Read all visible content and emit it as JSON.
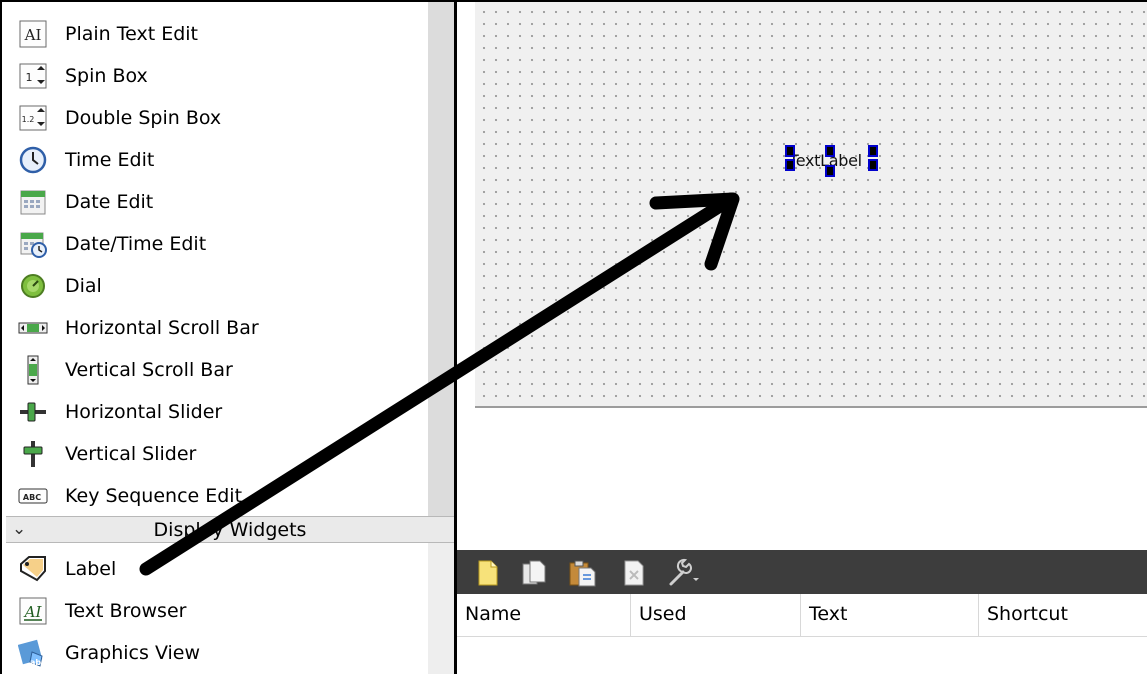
{
  "widget_box": {
    "items": [
      {
        "label": "Plain Text Edit",
        "icon": "plain-text-edit-icon"
      },
      {
        "label": "Spin Box",
        "icon": "spin-box-icon"
      },
      {
        "label": "Double Spin Box",
        "icon": "double-spin-box-icon"
      },
      {
        "label": "Time Edit",
        "icon": "time-edit-icon"
      },
      {
        "label": "Date Edit",
        "icon": "date-edit-icon"
      },
      {
        "label": "Date/Time Edit",
        "icon": "date-time-edit-icon"
      },
      {
        "label": "Dial",
        "icon": "dial-icon"
      },
      {
        "label": "Horizontal Scroll Bar",
        "icon": "horizontal-scroll-bar-icon"
      },
      {
        "label": "Vertical Scroll Bar",
        "icon": "vertical-scroll-bar-icon"
      },
      {
        "label": "Horizontal Slider",
        "icon": "horizontal-slider-icon"
      },
      {
        "label": "Vertical Slider",
        "icon": "vertical-slider-icon"
      },
      {
        "label": "Key Sequence Edit",
        "icon": "key-sequence-edit-icon"
      }
    ],
    "category": {
      "label": "Display Widgets",
      "chevron": "chevron-down-icon"
    },
    "display_items": [
      {
        "label": "Label",
        "icon": "label-icon"
      },
      {
        "label": "Text Browser",
        "icon": "text-browser-icon"
      },
      {
        "label": "Graphics View",
        "icon": "graphics-view-icon"
      }
    ],
    "icon_glyphs": {
      "plain_text": "AI",
      "spin": "1",
      "double_spin": "1.2",
      "key_seq": "ABC"
    }
  },
  "form": {
    "text_label": "TextLabel"
  },
  "action_editor": {
    "toolbar": [
      {
        "icon": "new-action-icon"
      },
      {
        "icon": "copy-action-icon"
      },
      {
        "icon": "paste-action-icon"
      },
      {
        "icon": "delete-action-icon"
      },
      {
        "icon": "configure-wrench-icon"
      }
    ],
    "columns": [
      "Name",
      "Used",
      "Text",
      "Shortcut"
    ]
  },
  "colors": {
    "arrow": "#000000",
    "handle_border": "#0000cc",
    "toolbar_bg": "#3d3d3d",
    "canvas_bg": "#f0f0f0"
  }
}
